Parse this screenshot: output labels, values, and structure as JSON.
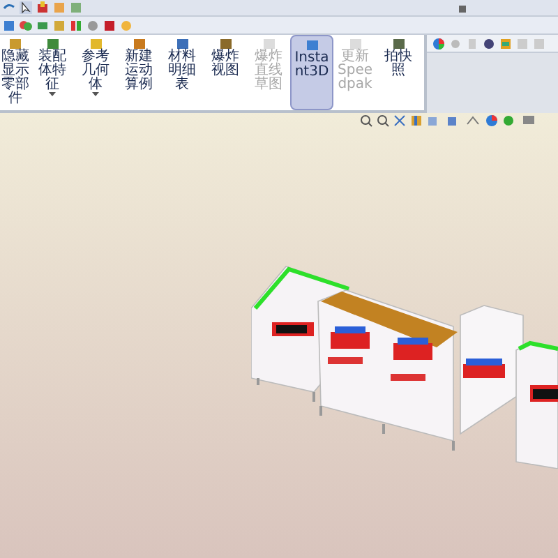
{
  "ribbon": {
    "buttons": [
      {
        "label": "隐藏显示零部件",
        "selected": false,
        "disabled": false,
        "dropdown": false
      },
      {
        "label": "装配体特征",
        "selected": false,
        "disabled": false,
        "dropdown": true
      },
      {
        "label": "参考几何体",
        "selected": false,
        "disabled": false,
        "dropdown": true
      },
      {
        "label": "新建运动算例",
        "selected": false,
        "disabled": false,
        "dropdown": false
      },
      {
        "label": "材料明细表",
        "selected": false,
        "disabled": false,
        "dropdown": false
      },
      {
        "label": "爆炸视图",
        "selected": false,
        "disabled": false,
        "dropdown": false
      },
      {
        "label": "爆炸直线草图",
        "selected": false,
        "disabled": true,
        "dropdown": false
      },
      {
        "label": "Instant3D",
        "selected": true,
        "disabled": false,
        "dropdown": false
      },
      {
        "label": "更新 Speedpak",
        "selected": false,
        "disabled": true,
        "dropdown": false
      },
      {
        "label": "拍快照",
        "selected": false,
        "disabled": false,
        "dropdown": false
      }
    ]
  }
}
